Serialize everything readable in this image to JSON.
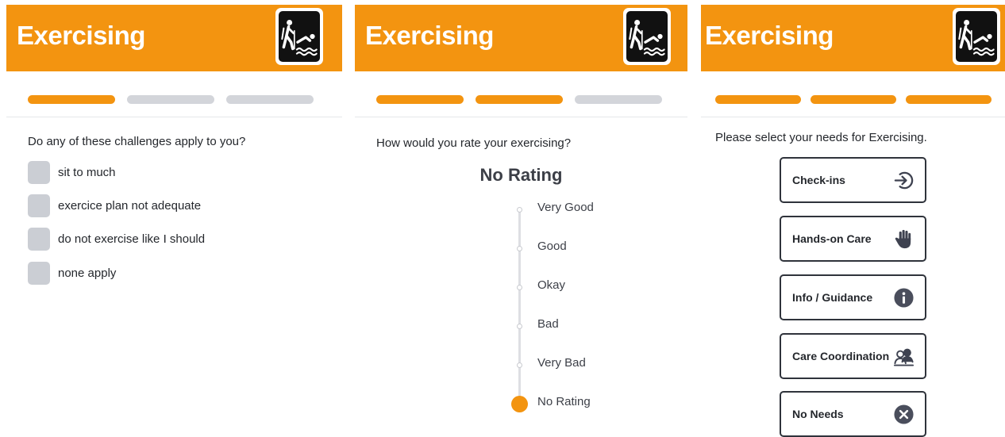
{
  "screens": [
    {
      "title": "Exercising",
      "icon": "hiking-swimming-icon",
      "progress_completed": 1,
      "progress_total": 3,
      "question": "Do any of these challenges apply to you?",
      "options": [
        {
          "label": "sit to much",
          "checked": false
        },
        {
          "label": "exercice plan not adequate",
          "checked": false
        },
        {
          "label": "do not exercise like I should",
          "checked": false
        },
        {
          "label": "none apply",
          "checked": false
        }
      ]
    },
    {
      "title": "Exercising",
      "icon": "hiking-swimming-icon",
      "progress_completed": 2,
      "progress_total": 3,
      "question": "How would you rate your exercising?",
      "current_rating": "No Rating",
      "rating_levels": [
        "Very Good",
        "Good",
        "Okay",
        "Bad",
        "Very Bad",
        "No Rating"
      ],
      "selected_level": "No Rating"
    },
    {
      "title": "Exercising",
      "icon": "hiking-swimming-icon",
      "progress_completed": 3,
      "progress_total": 3,
      "question": "Please select your needs for Exercising.",
      "needs": [
        {
          "label": "Check-ins",
          "icon": "sign-in-arrow-icon"
        },
        {
          "label": "Hands-on Care",
          "icon": "hand-icon"
        },
        {
          "label": "Info / Guidance",
          "icon": "info-icon"
        },
        {
          "label": "Care Coordination",
          "icon": "people-icon"
        },
        {
          "label": "No Needs",
          "icon": "close-circle-icon"
        }
      ]
    }
  ],
  "colors": {
    "accent": "#f39410",
    "inactive_segment": "#d3d5da",
    "checkbox": "#cbced4",
    "text": "#24272c",
    "border": "#2f333b",
    "icon_dark": "#3e4250"
  }
}
